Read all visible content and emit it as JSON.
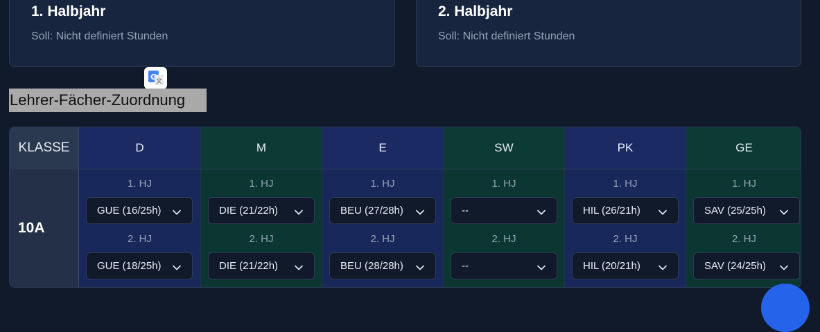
{
  "cards": [
    {
      "title": "1. Halbjahr",
      "subtitle": "Soll: Nicht definiert Stunden"
    },
    {
      "title": "2. Halbjahr",
      "subtitle": "Soll: Nicht definiert Stunden"
    }
  ],
  "section_title": "Lehrer-Fächer-Zuordnung",
  "table": {
    "class_header": "KLASSE",
    "subjects": [
      "D",
      "M",
      "E",
      "SW",
      "PK",
      "GE"
    ],
    "row": {
      "class": "10A",
      "hj1_label": "1. HJ",
      "hj2_label": "2. HJ",
      "hj1": [
        "GUE (16/25h)",
        "DIE (21/22h)",
        "BEU (27/28h)",
        "--",
        "HIL (26/21h)",
        "SAV (25/25h)"
      ],
      "hj2": [
        "GUE (18/25h)",
        "DIE (21/22h)",
        "BEU (28/28h)",
        "--",
        "HIL (20/21h)",
        "SAV (24/25h)"
      ]
    }
  },
  "icons": {
    "translate": "google-translate-icon",
    "select_chevron": "chevron-down-icon"
  },
  "colors": {
    "background": "#111a2b",
    "blue_column": "#1b2a63",
    "green_column": "#0c3b36",
    "fab": "#2563eb"
  }
}
